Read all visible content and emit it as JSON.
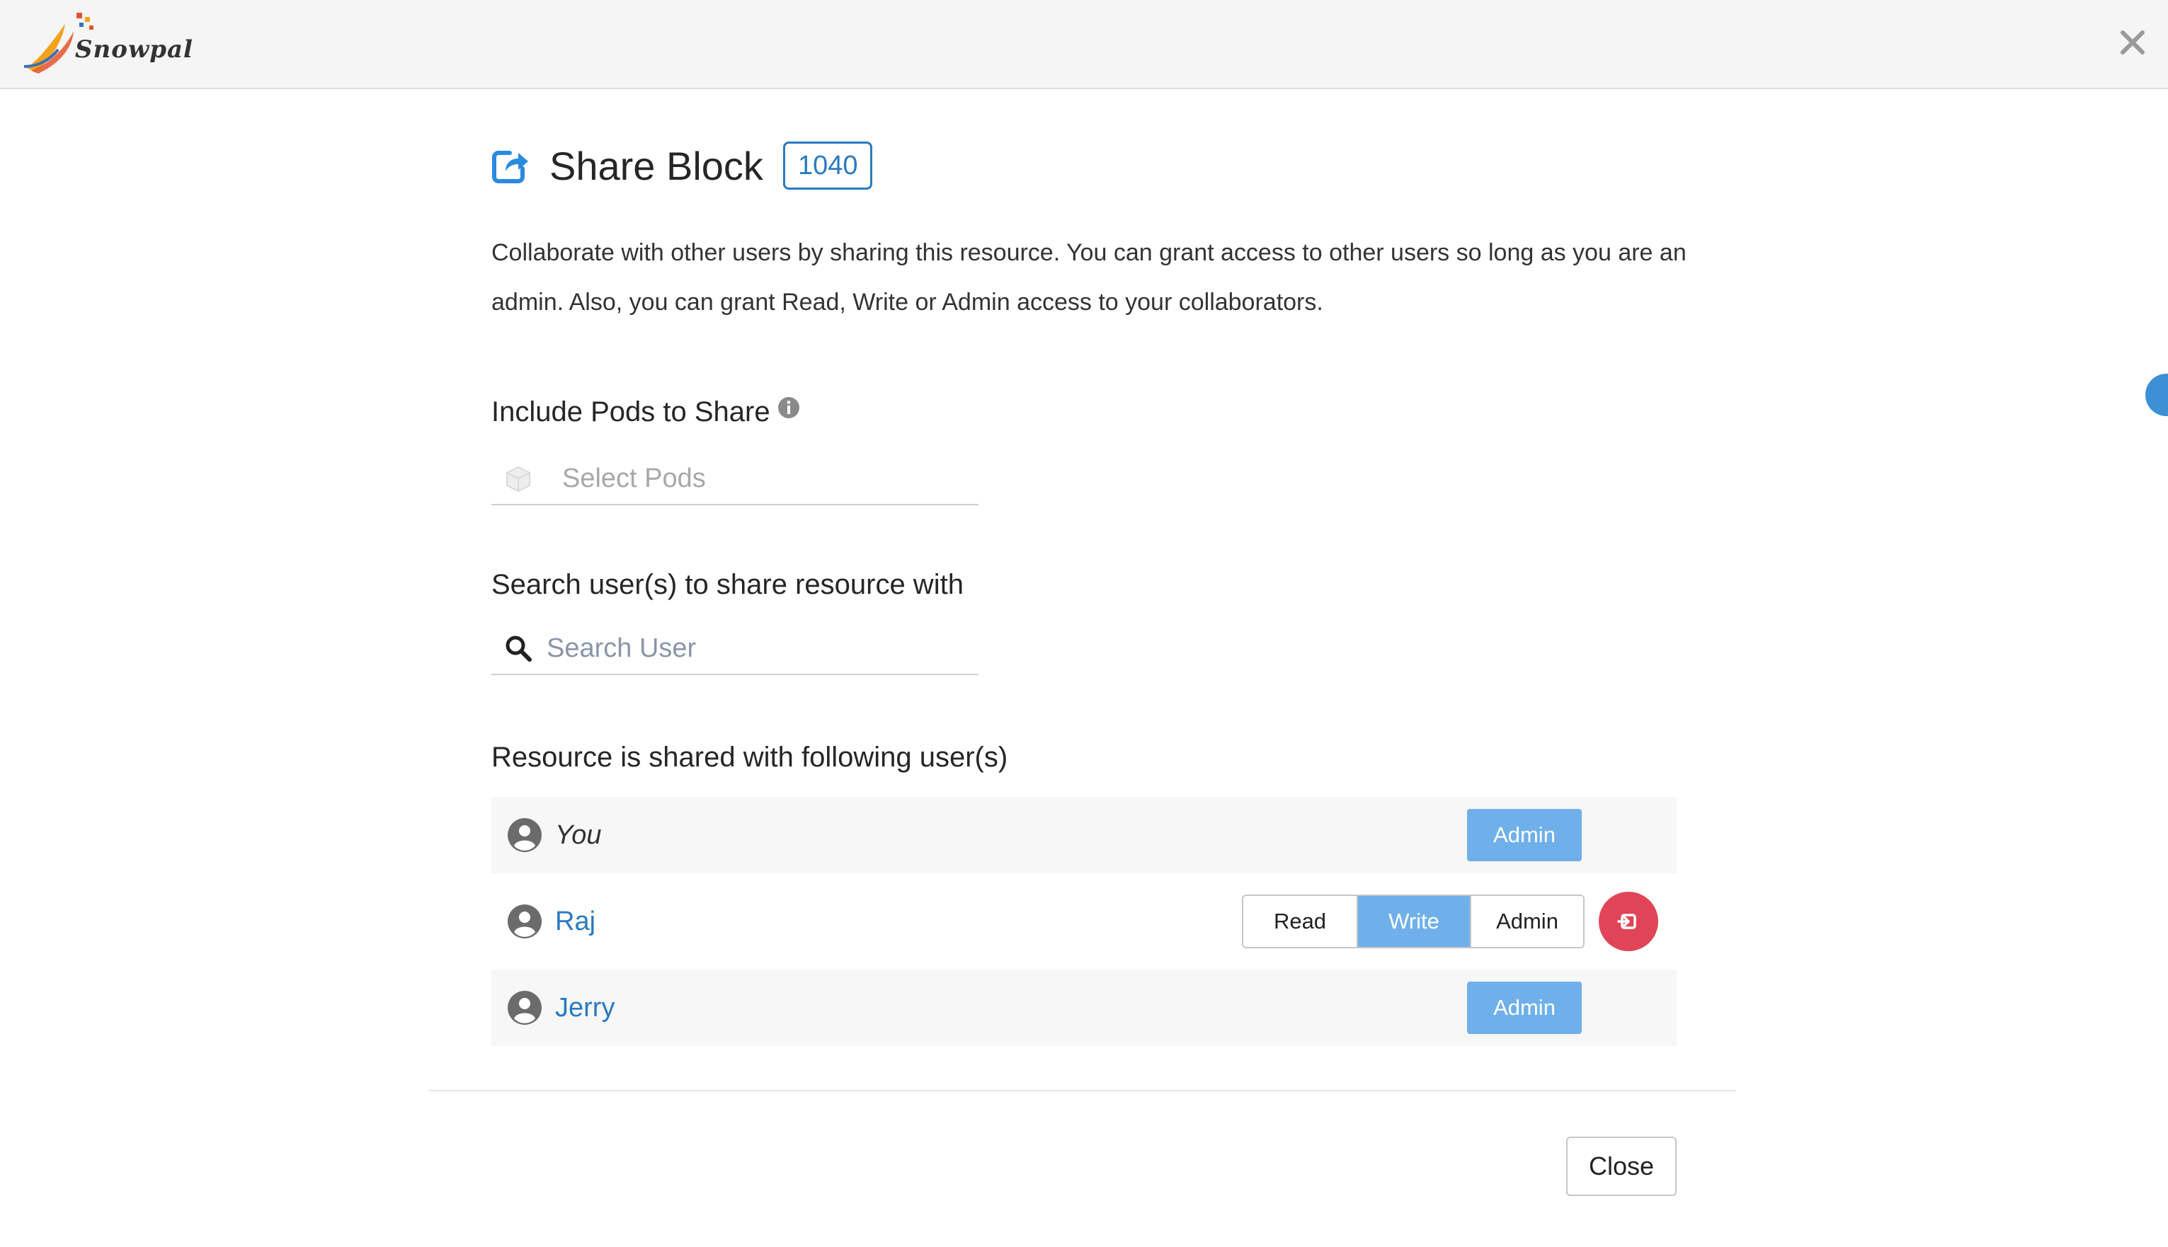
{
  "app": {
    "logo_text": "Snowpal"
  },
  "modal": {
    "title": "Share Block",
    "resource_id": "1040",
    "description": "Collaborate with other users by sharing this resource. You can grant access to other users so long as you are an admin. Also, you can grant Read, Write or Admin access to your collaborators.",
    "pods_section": {
      "heading": "Include Pods to Share",
      "placeholder": "Select Pods"
    },
    "search_section": {
      "heading": "Search user(s) to share resource with",
      "placeholder": "Search User"
    },
    "shared_section": {
      "heading": "Resource is shared with following user(s)"
    },
    "users": [
      {
        "name": "You",
        "role": "Admin"
      },
      {
        "name": "Raj",
        "permissions": [
          "Read",
          "Write",
          "Admin"
        ],
        "selected": "Write"
      },
      {
        "name": "Jerry",
        "role": "Admin"
      }
    ],
    "close_label": "Close"
  },
  "icons": {
    "top_close": "close-icon",
    "title": "share-icon",
    "info": "info-icon",
    "pods": "cube-icon",
    "search": "search-icon",
    "avatar": "user-avatar-icon",
    "revoke": "revoke-icon"
  },
  "colors": {
    "accent": "#2a7ac0",
    "button_active": "#6fb0ea",
    "danger": "#e04557",
    "topbar_bg": "#f5f5f5"
  }
}
